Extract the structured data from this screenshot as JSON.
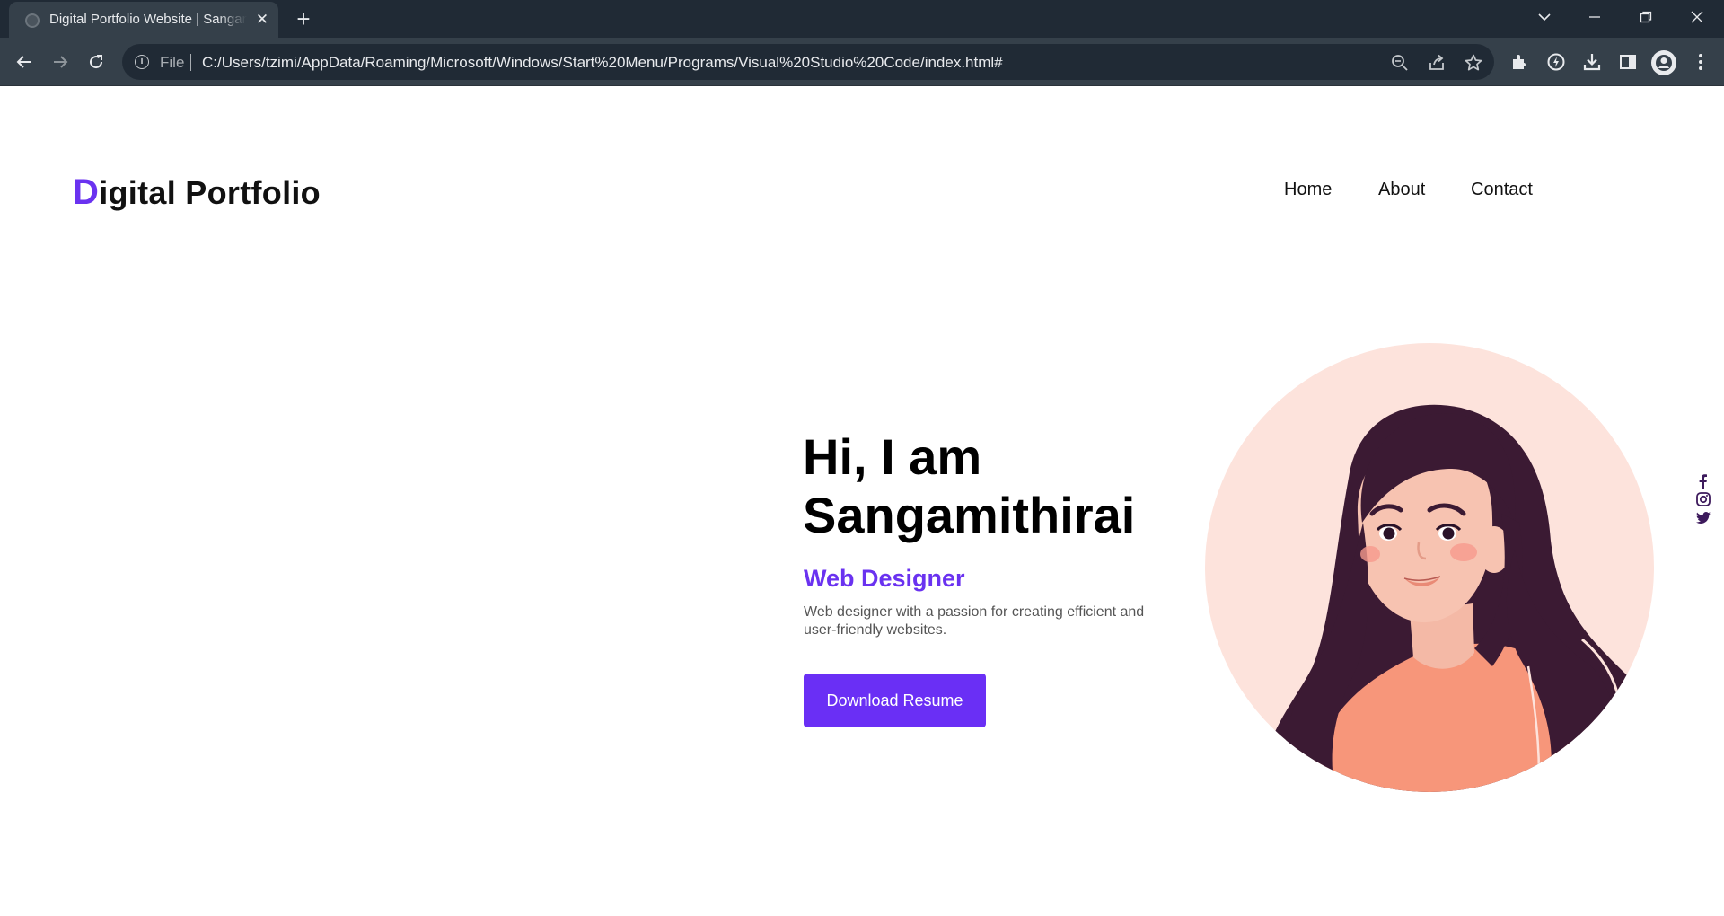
{
  "browser": {
    "tab_title": "Digital Portfolio Website | Sangamithirai",
    "new_tab_symbol": "+",
    "close_symbol": "✕",
    "address_scheme": "File",
    "address_url": "C:/Users/tzimi/AppData/Roaming/Microsoft/Windows/Start%20Menu/Programs/Visual%20Studio%20Code/index.html#",
    "icons": [
      "back-icon",
      "forward-icon",
      "reload-icon",
      "info-icon",
      "zoom-icon",
      "share-icon",
      "star-icon",
      "extensions-icon",
      "speed-icon",
      "download-icon",
      "sidepanel-icon",
      "profile-icon",
      "menu-icon"
    ]
  },
  "site": {
    "logo_first": "D",
    "logo_rest": "igital Portfolio",
    "nav": [
      "Home",
      "About",
      "Contact"
    ]
  },
  "hero": {
    "greeting_line1": "Hi, I am",
    "greeting_line2": "Sangamithirai",
    "role": "Web Designer",
    "description": "Web designer with a passion for creating efficient and user-friendly websites.",
    "button": "Download Resume"
  },
  "social": [
    "facebook-icon",
    "instagram-icon",
    "twitter-icon"
  ],
  "colors": {
    "accent": "#6a32f0",
    "button": "#6a2ff5",
    "social": "#3d1a5c",
    "portrait_bg": "#fde3dc"
  }
}
